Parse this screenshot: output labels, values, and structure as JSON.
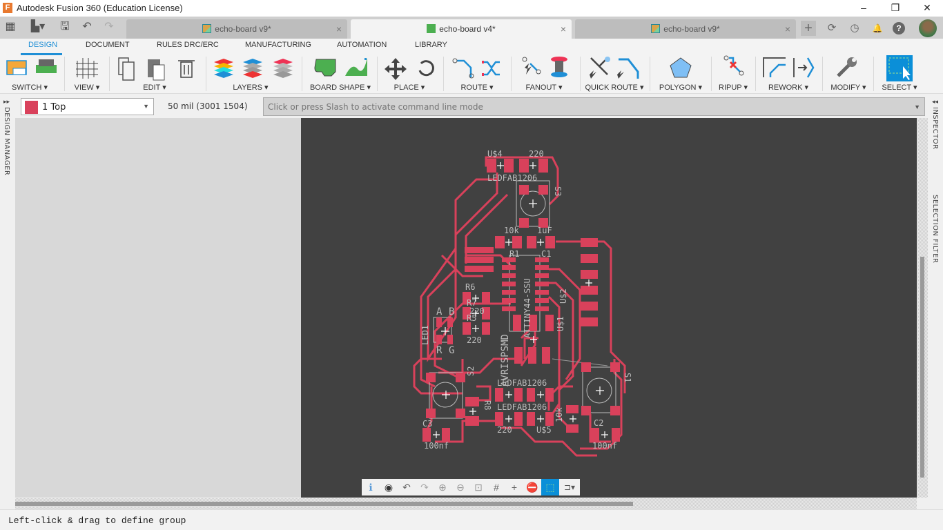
{
  "app": {
    "title": "Autodesk Fusion 360 (Education License)",
    "icon": "fusion-logo-icon"
  },
  "window_controls": {
    "minimize": "–",
    "restore": "❐",
    "close": "✕"
  },
  "quick_access": [
    {
      "name": "apps-grid-icon",
      "glyph": "▦"
    },
    {
      "name": "file-menu-icon",
      "glyph": "▙▾"
    },
    {
      "name": "save-icon",
      "glyph": "🖫"
    },
    {
      "name": "undo-icon",
      "glyph": "↶"
    },
    {
      "name": "redo-icon",
      "glyph": "↷"
    }
  ],
  "document_tabs": [
    {
      "label": "echo-board v9*",
      "active": false,
      "close": "×"
    },
    {
      "label": "echo-board v4*",
      "active": true,
      "close": "×"
    },
    {
      "label": "echo-board v9*",
      "active": false,
      "close": "×"
    }
  ],
  "top_right_icons": [
    {
      "name": "new-tab-icon",
      "glyph": "+"
    },
    {
      "name": "extensions-icon",
      "glyph": "⟳"
    },
    {
      "name": "job-status-icon",
      "glyph": "◷"
    },
    {
      "name": "notifications-icon",
      "glyph": "🔔"
    },
    {
      "name": "help-icon",
      "glyph": "?"
    }
  ],
  "ribbon": {
    "tabs": [
      "DESIGN",
      "DOCUMENT",
      "RULES DRC/ERC",
      "MANUFACTURING",
      "AUTOMATION",
      "LIBRARY"
    ],
    "active_tab": "DESIGN",
    "groups": [
      "SWITCH ▾",
      "VIEW ▾",
      "EDIT ▾",
      "LAYERS ▾",
      "BOARD SHAPE ▾",
      "PLACE ▾",
      "ROUTE ▾",
      "FANOUT ▾",
      "QUICK ROUTE ▾",
      "POLYGON ▾",
      "RIPUP ▾",
      "REWORK ▾",
      "MODIFY ▾",
      "SELECT ▾"
    ]
  },
  "toolbar": {
    "layer": "1 Top",
    "layer_color": "#d9415b",
    "grid_info": "50 mil (3001 1504)",
    "command_placeholder": "Click or press Slash to activate command line mode"
  },
  "side_panels": {
    "left": "DESIGN MANAGER",
    "right_top": "INSPECTOR",
    "right_bottom": "SELECTION FILTER",
    "left_arrow": "▸▸",
    "right_arrow": "◂◂"
  },
  "pcb": {
    "trace_color": "#d9415b",
    "silk_color": "#bdbdbd",
    "labels": [
      "U$4",
      "220",
      "LEDFAB1206",
      "S3",
      "10k",
      "1uF",
      "R1",
      "C1",
      "U$2",
      "ATTINY44-SSU",
      "U$1",
      "R6",
      "R7",
      "R5",
      "220",
      "220",
      "A",
      "B",
      "R",
      "G",
      "LED1",
      "AVRISPSMD",
      "S2",
      "S1",
      "R8",
      "LEDFAB1206",
      "LEDFAB1206",
      "220",
      "U$5",
      "10k",
      "C2",
      "100nf",
      "100nf",
      "C3"
    ]
  },
  "minibar": [
    {
      "name": "info-icon",
      "glyph": "ℹ"
    },
    {
      "name": "visibility-icon",
      "glyph": "◉"
    },
    {
      "name": "undo-icon",
      "glyph": "↶"
    },
    {
      "name": "redo-icon",
      "glyph": "↷"
    },
    {
      "name": "zoom-in-icon",
      "glyph": "⊕"
    },
    {
      "name": "zoom-out-icon",
      "glyph": "⊖"
    },
    {
      "name": "zoom-fit-icon",
      "glyph": "⊡"
    },
    {
      "name": "grid-icon",
      "glyph": "#"
    },
    {
      "name": "crosshair-icon",
      "glyph": "+"
    },
    {
      "name": "stop-icon",
      "glyph": "⛔"
    },
    {
      "name": "select-group-icon",
      "glyph": "⬚"
    },
    {
      "name": "route-options-icon",
      "glyph": "⊐▾"
    }
  ],
  "status": {
    "message": "Left-click & drag to define group"
  }
}
